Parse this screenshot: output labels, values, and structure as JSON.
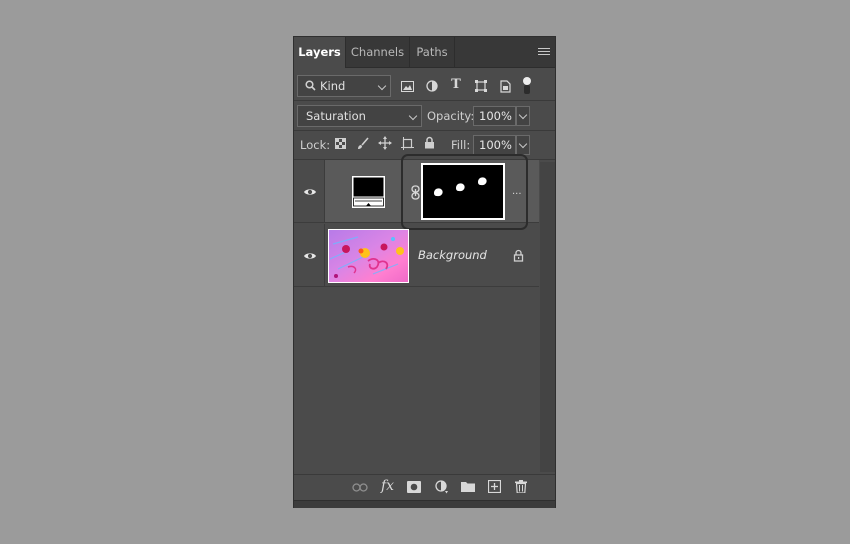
{
  "tabs": [
    {
      "label": "Layers"
    },
    {
      "label": "Channels"
    },
    {
      "label": "Paths"
    }
  ],
  "filter": {
    "kind_label": "Kind",
    "icons": [
      "pixel-layer-filter-icon",
      "adjustment-layer-filter-icon",
      "type-layer-filter-icon",
      "shape-layer-filter-icon",
      "smart-object-filter-icon",
      "filter-toggle-icon"
    ]
  },
  "blend": {
    "mode": "Saturation",
    "opacity_label": "Opacity:",
    "opacity_value": "100%"
  },
  "lock": {
    "label": "Lock:",
    "fill_label": "Fill:",
    "fill_value": "100%"
  },
  "layers": [
    {
      "name": "",
      "type": "adjustment-saturation",
      "selected": true,
      "has_mask": true
    },
    {
      "name": "Background",
      "type": "image",
      "selected": false,
      "locked": true
    }
  ],
  "more_glyph": "...",
  "colors": {
    "panel_bg": "#4b4b4b",
    "selected_row": "#5a5a5a",
    "background": "#9b9b9b"
  }
}
